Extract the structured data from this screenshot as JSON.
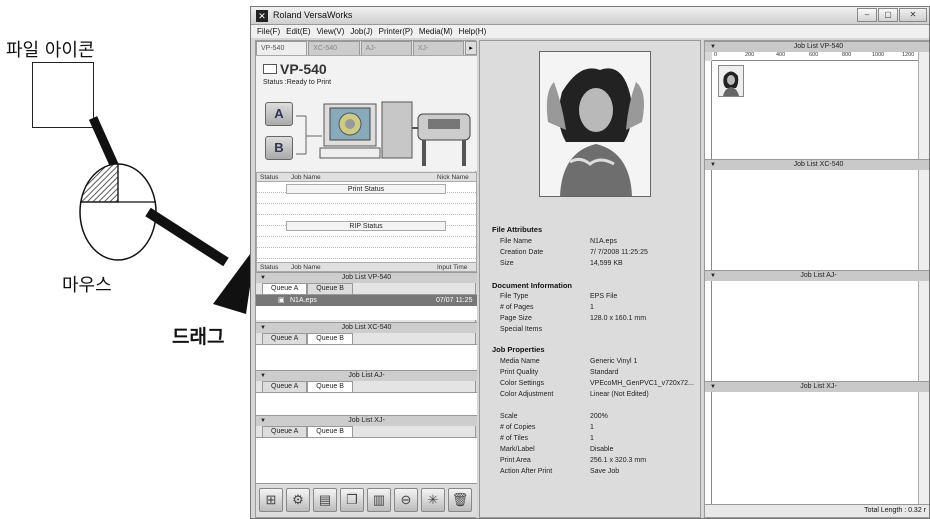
{
  "diagram": {
    "file_icon_label": "파일 아이콘",
    "mouse_label": "마우스",
    "drag_label": "드래그"
  },
  "window": {
    "title": "Roland VersaWorks",
    "controls": {
      "minimize": "–",
      "maximize": "▢",
      "close": "✕"
    }
  },
  "menu": [
    "File(F)",
    "Edit(E)",
    "View(V)",
    "Job(J)",
    "Printer(P)",
    "Media(M)",
    "Help(H)"
  ],
  "printer_tabs": [
    {
      "label": "VP-540",
      "active": true
    },
    {
      "label": "XC-540",
      "active": false
    },
    {
      "label": "AJ-",
      "active": false
    },
    {
      "label": "XJ-",
      "active": false
    }
  ],
  "printer_tabs_next": "▸",
  "printer": {
    "name": "VP-540",
    "status": "Status :Ready to Print",
    "queue_a": "A",
    "queue_b": "B"
  },
  "status_grid": {
    "columns": [
      "Status",
      "Job Name",
      "Nick Name"
    ],
    "print_status": "Print Status",
    "rip_status": "RIP Status"
  },
  "job_grid": {
    "columns": [
      "Status",
      "Job Name",
      "Input Time"
    ]
  },
  "job_lists": [
    {
      "title": "Job List VP-540",
      "queue_a": "Queue A",
      "queue_b": "Queue B",
      "active": "A"
    },
    {
      "title": "Job List XC-540",
      "queue_a": "Queue A",
      "queue_b": "Queue B",
      "active": "B"
    },
    {
      "title": "Job List AJ-",
      "queue_a": "Queue A",
      "queue_b": "Queue B",
      "active": "B"
    },
    {
      "title": "Job List XJ-",
      "queue_a": "Queue A",
      "queue_b": "Queue B",
      "active": "B"
    }
  ],
  "job_row": {
    "name": "N1A.eps",
    "time": "07/07 11:25"
  },
  "toolbar": [
    "add-job",
    "settings",
    "print",
    "duplicate",
    "printer-control",
    "cancel",
    "rip",
    "delete"
  ],
  "file_attributes": {
    "heading": "File Attributes",
    "rows": [
      {
        "k": "File Name",
        "v": "N1A.eps"
      },
      {
        "k": "Creation Date",
        "v": "7/ 7/2008 11:25:25"
      },
      {
        "k": "Size",
        "v": "14,599 KB"
      }
    ]
  },
  "document_info": {
    "heading": "Document Information",
    "rows": [
      {
        "k": "File Type",
        "v": "EPS File"
      },
      {
        "k": "# of Pages",
        "v": "1"
      },
      {
        "k": "Page Size",
        "v": "128.0 x 160.1 mm"
      },
      {
        "k": "Special Items",
        "v": ""
      }
    ]
  },
  "job_properties": {
    "heading": "Job Properties",
    "rows": [
      {
        "k": "Media Name",
        "v": "Generic Vinyl 1"
      },
      {
        "k": "Print Quality",
        "v": "Standard"
      },
      {
        "k": "Color Settings",
        "v": "VPEcoMH_GenPVC1_v720x72..."
      },
      {
        "k": "Color Adjustment",
        "v": "Linear (Not Edited)"
      }
    ],
    "rows2": [
      {
        "k": "Scale",
        "v": "200%"
      },
      {
        "k": "# of Copies",
        "v": "1"
      },
      {
        "k": "# of Tiles",
        "v": "1"
      },
      {
        "k": "Mark/Label",
        "v": "Disable"
      },
      {
        "k": "Print Area",
        "v": "256.1 x 320.3 mm"
      },
      {
        "k": "Action After Print",
        "v": "Save Job"
      }
    ]
  },
  "right_lists": [
    {
      "title": "Job List VP-540"
    },
    {
      "title": "Job List XC-540"
    },
    {
      "title": "Job List AJ-"
    },
    {
      "title": "Job List XJ-"
    }
  ],
  "ruler_ticks": [
    "0",
    "200",
    "400",
    "600",
    "800",
    "1000",
    "1200"
  ],
  "ruler_v_ticks": [
    "0",
    "200",
    "400"
  ],
  "status_bar": "Total Length : 0.32 r",
  "colors": {
    "window_bg": "#d6d6d6",
    "selected_row": "#777777",
    "diagram_stroke": "#111111"
  }
}
